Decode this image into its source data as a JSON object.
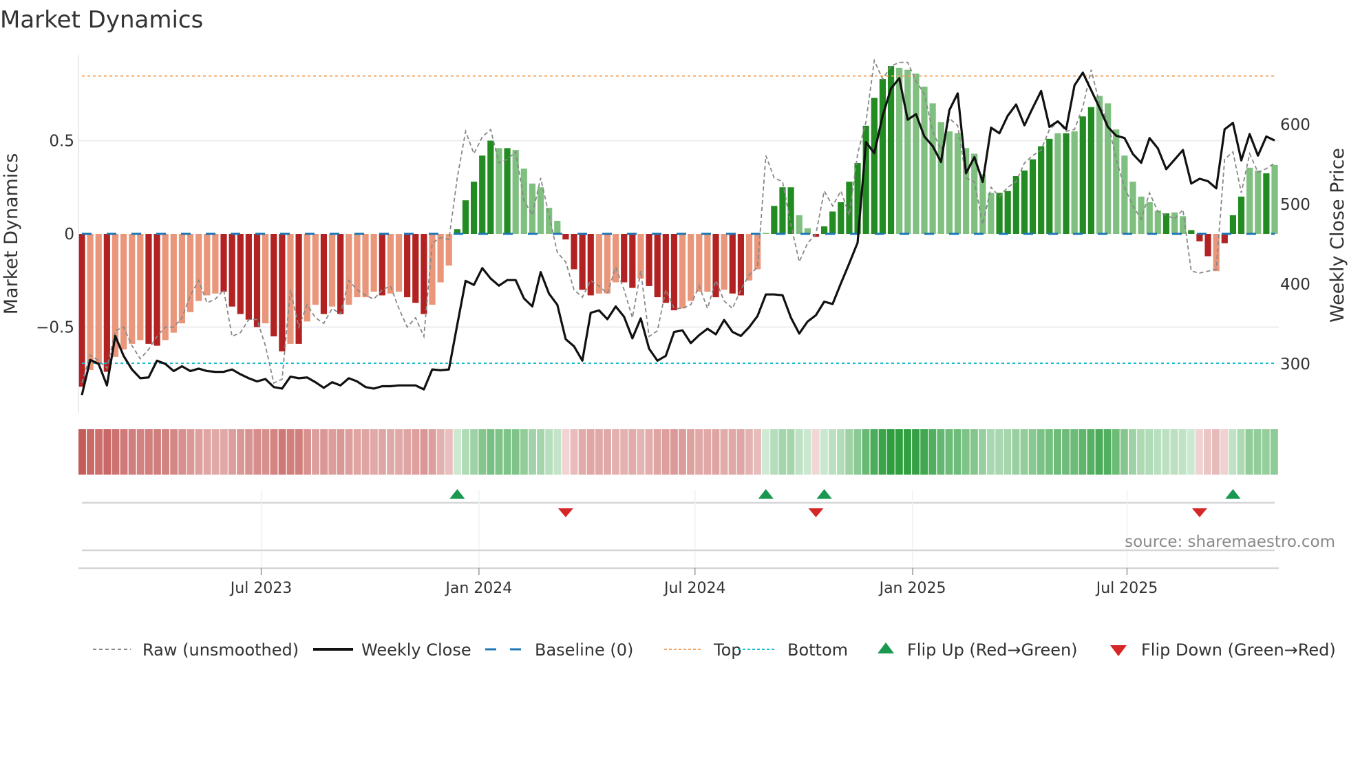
{
  "chart_data": {
    "type": "bar",
    "title": "Market Dynamics",
    "ylabel": "Market Dynamics",
    "ylabel_right": "Weekly Close Price",
    "source": "source: sharemaestro.com",
    "ylim": [
      -0.9,
      0.95
    ],
    "y_ticks": [
      {
        "v": 0.5,
        "label": "0.5"
      },
      {
        "v": 0,
        "label": "0"
      },
      {
        "v": -0.5,
        "label": "−0.5"
      }
    ],
    "y2_ticks": [
      {
        "v": 600,
        "label": "600"
      },
      {
        "v": 500,
        "label": "500"
      },
      {
        "v": 400,
        "label": "400"
      },
      {
        "v": 300,
        "label": "300"
      }
    ],
    "x_ticks": [
      {
        "week": 21.5,
        "label": "Jul 2023"
      },
      {
        "week": 47.6,
        "label": "Jan 2024"
      },
      {
        "week": 73.5,
        "label": "Jul 2024"
      },
      {
        "week": 99.6,
        "label": "Jan 2025"
      },
      {
        "week": 125.3,
        "label": "Jul 2025"
      }
    ],
    "top_level": 0.847,
    "bottom_level": -0.694,
    "baseline": 0,
    "momentum": [
      -0.82,
      -0.73,
      -0.7,
      -0.74,
      -0.66,
      -0.62,
      -0.59,
      -0.57,
      -0.59,
      -0.6,
      -0.57,
      -0.53,
      -0.48,
      -0.42,
      -0.36,
      -0.33,
      -0.32,
      -0.31,
      -0.39,
      -0.43,
      -0.46,
      -0.5,
      -0.48,
      -0.55,
      -0.63,
      -0.59,
      -0.59,
      -0.47,
      -0.38,
      -0.43,
      -0.39,
      -0.43,
      -0.38,
      -0.34,
      -0.34,
      -0.31,
      -0.33,
      -0.32,
      -0.31,
      -0.34,
      -0.37,
      -0.43,
      -0.38,
      -0.26,
      -0.17,
      0.025,
      0.18,
      0.28,
      0.42,
      0.5,
      0.46,
      0.46,
      0.45,
      0.35,
      0.27,
      0.25,
      0.14,
      0.07,
      -0.03,
      -0.19,
      -0.3,
      -0.33,
      -0.32,
      -0.32,
      -0.26,
      -0.26,
      -0.29,
      -0.24,
      -0.28,
      -0.34,
      -0.37,
      -0.41,
      -0.4,
      -0.36,
      -0.31,
      -0.31,
      -0.34,
      -0.3,
      -0.32,
      -0.33,
      -0.25,
      -0.19,
      0.005,
      0.15,
      0.25,
      0.25,
      0.1,
      0.03,
      -0.016,
      0.04,
      0.12,
      0.17,
      0.28,
      0.38,
      0.58,
      0.73,
      0.83,
      0.9,
      0.89,
      0.88,
      0.86,
      0.79,
      0.7,
      0.6,
      0.55,
      0.54,
      0.46,
      0.43,
      0.32,
      0.22,
      0.22,
      0.23,
      0.31,
      0.34,
      0.4,
      0.47,
      0.51,
      0.54,
      0.54,
      0.55,
      0.63,
      0.68,
      0.74,
      0.7,
      0.56,
      0.42,
      0.28,
      0.2,
      0.17,
      0.125,
      0.11,
      0.115,
      0.095,
      0.02,
      -0.04,
      -0.12,
      -0.2,
      -0.05,
      0.1,
      0.2,
      0.355,
      0.34,
      0.325,
      0.37
    ],
    "shade": "DLLDLLLLDDLLLLLLLDDDDDLDDLDLLDLDLLLLDLLDDDLLLDDDDDLDLLLLLLDDDDLLLDDLDDDDLLLLDLDDLLLDDDLLDDDDDDDDDDLLLLLLLLLLLLDDDDDDDLDLDDLLLLLLLLDLLDDDLDDDLLD",
    "raw": [
      -0.8,
      -0.65,
      -0.68,
      -0.72,
      -0.52,
      -0.5,
      -0.6,
      -0.67,
      -0.62,
      -0.55,
      -0.5,
      -0.5,
      -0.45,
      -0.33,
      -0.25,
      -0.37,
      -0.35,
      -0.3,
      -0.55,
      -0.53,
      -0.46,
      -0.46,
      -0.6,
      -0.8,
      -0.78,
      -0.3,
      -0.5,
      -0.38,
      -0.45,
      -0.48,
      -0.4,
      -0.43,
      -0.25,
      -0.3,
      -0.33,
      -0.35,
      -0.3,
      -0.28,
      -0.4,
      -0.5,
      -0.45,
      -0.55,
      -0.05,
      -0.02,
      -0.03,
      0.3,
      0.55,
      0.43,
      0.52,
      0.56,
      0.38,
      0.4,
      0.44,
      0.18,
      0.1,
      0.3,
      0.1,
      -0.1,
      -0.15,
      -0.3,
      -0.34,
      -0.25,
      -0.28,
      -0.32,
      -0.18,
      -0.3,
      -0.45,
      -0.2,
      -0.55,
      -0.52,
      -0.3,
      -0.4,
      -0.4,
      -0.38,
      -0.28,
      -0.4,
      -0.25,
      -0.36,
      -0.4,
      -0.3,
      -0.22,
      -0.18,
      0.42,
      0.3,
      0.28,
      0.05,
      -0.15,
      -0.05,
      0.0,
      0.23,
      0.15,
      0.23,
      0.1,
      0.43,
      0.6,
      0.93,
      0.83,
      0.9,
      0.92,
      0.92,
      0.82,
      0.75,
      0.55,
      0.45,
      0.62,
      0.58,
      0.3,
      0.28,
      0.05,
      0.25,
      0.2,
      0.25,
      0.28,
      0.38,
      0.42,
      0.45,
      0.56,
      0.6,
      0.55,
      0.56,
      0.68,
      0.88,
      0.7,
      0.6,
      0.4,
      0.25,
      0.15,
      0.08,
      0.22,
      0.12,
      0.1,
      0.08,
      0.13,
      -0.2,
      -0.21,
      -0.2,
      -0.19,
      0.4,
      0.44,
      0.22,
      0.43,
      0.33,
      0.35,
      0.38
    ],
    "weekly_close": [
      261,
      305,
      300,
      273,
      335,
      310,
      293,
      282,
      283,
      304,
      300,
      291,
      297,
      291,
      294,
      291,
      290,
      290,
      293,
      287,
      282,
      278,
      281,
      271,
      269,
      284,
      282,
      283,
      277,
      270,
      277,
      273,
      282,
      278,
      271,
      269,
      272,
      272,
      273,
      273,
      273,
      268,
      293,
      292,
      293,
      349,
      404,
      399,
      420,
      407,
      398,
      405,
      405,
      382,
      372,
      415,
      388,
      374,
      331,
      322,
      304,
      364,
      367,
      356,
      372,
      359,
      332,
      357,
      319,
      304,
      310,
      340,
      342,
      326,
      336,
      344,
      337,
      355,
      340,
      335,
      346,
      360,
      387,
      387,
      386,
      358,
      338,
      353,
      361,
      378,
      375,
      401,
      426,
      452,
      578,
      564,
      611,
      645,
      658,
      606,
      613,
      585,
      573,
      553,
      618,
      639,
      539,
      559,
      528,
      596,
      589,
      611,
      625,
      599,
      621,
      642,
      597,
      604,
      594,
      649,
      665,
      643,
      621,
      597,
      586,
      583,
      563,
      552,
      583,
      570,
      544,
      556,
      568,
      526,
      532,
      529,
      520,
      594,
      602,
      555,
      588,
      561,
      585,
      580
    ],
    "flip_up_weeks": [
      45,
      82,
      89,
      138
    ],
    "flip_down_weeks": [
      58,
      88,
      134
    ],
    "legend": [
      {
        "label": "Raw (unsmoothed)",
        "kind": "raw"
      },
      {
        "label": "Weekly Close",
        "kind": "close"
      },
      {
        "label": "Baseline (0)",
        "kind": "baseline"
      },
      {
        "label": "Top",
        "kind": "top"
      },
      {
        "label": "Bottom",
        "kind": "bottom"
      },
      {
        "label": "Flip Up (Red→Green)",
        "kind": "up"
      },
      {
        "label": "Flip Down (Green→Red)",
        "kind": "down"
      }
    ],
    "colors": {
      "dark_green": "#228b22",
      "light_green": "#7fbf7f",
      "dark_red": "#b22222",
      "light_red": "#e9967a",
      "top": "#f4a460",
      "bottom": "#17becf",
      "baseline": "#1f77b4",
      "raw": "#888888",
      "close": "#111111",
      "flip_up": "#1a9850",
      "flip_down": "#d62728",
      "heat_red": "#c0504d",
      "heat_green": "#2e9e3e"
    }
  }
}
